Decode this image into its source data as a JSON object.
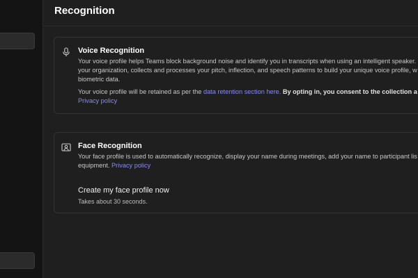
{
  "header": {
    "title": "Recognition"
  },
  "voice": {
    "icon": "microphone-icon",
    "title": "Voice Recognition",
    "line1": "Your voice profile helps Teams block background noise and identify you in transcripts when using an intelligent speaker.",
    "line2": "your organization, collects and processes your pitch, inflection, and speech patterns to build your unique voice profile, w",
    "line3": "biometric data.",
    "retention_prefix": "Your voice profile will be retained as per the",
    "retention_link": "data retention section here.",
    "consent_text": "By opting in, you consent to the collection a",
    "privacy_link": "Privacy policy"
  },
  "face": {
    "icon": "face-id-icon",
    "title": "Face Recognition",
    "line1": "Your face profile is used to automatically recognize, display your name during meetings, add your name to participant lis",
    "line2_prefix": "equipment.",
    "privacy_link": "Privacy policy",
    "cta_title": "Create my face profile now",
    "cta_subtitle": "Takes about 30 seconds."
  },
  "colors": {
    "accent_link": "#8b8cf0",
    "background": "#1f1f1f",
    "sidebar": "#141414"
  }
}
